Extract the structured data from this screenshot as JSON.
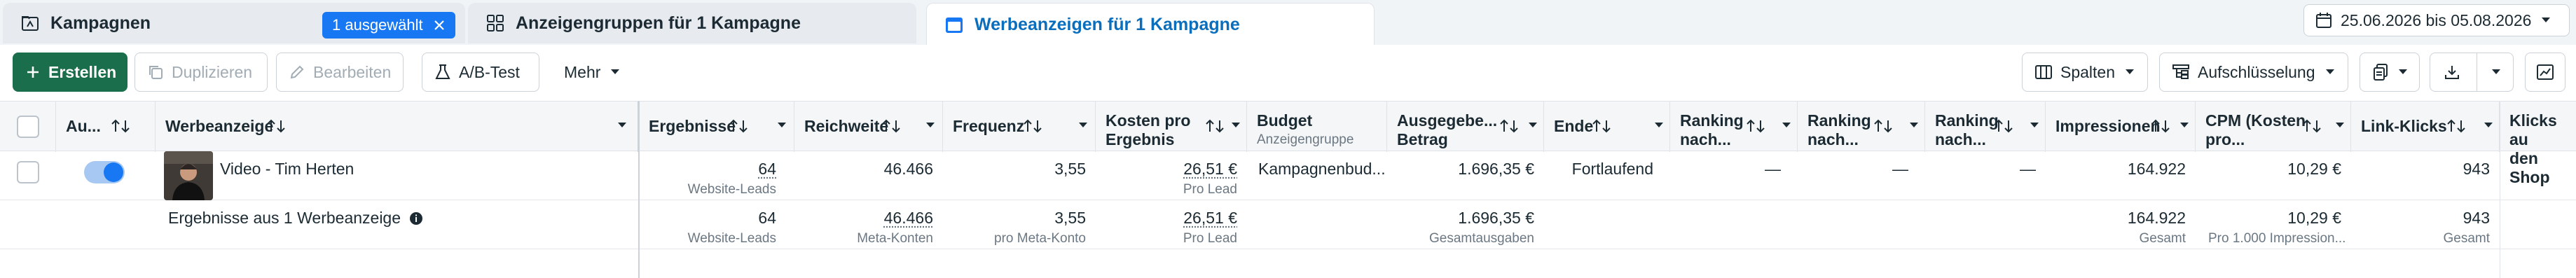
{
  "tabs": [
    {
      "label": "Kampagnen",
      "icon": "campaign-folder-icon"
    },
    {
      "label": "Anzeigengruppen für 1 Kampagne",
      "icon": "adset-grid-icon"
    },
    {
      "label": "Werbeanzeigen für 1 Kampagne",
      "icon": "ad-window-icon"
    }
  ],
  "selection_badge": "1 ausgewählt",
  "date_range": "25.06.2026 bis 05.08.2026",
  "toolbar": {
    "create": "Erstellen",
    "duplicate": "Duplizieren",
    "edit": "Bearbeiten",
    "ab_test": "A/B-Test",
    "more": "Mehr",
    "columns": "Spalten",
    "breakdown": "Aufschlüsselung"
  },
  "columns": {
    "status": "Au...",
    "ad": "Werbeanzeige",
    "results": "Ergebnisse",
    "reach": "Reichweite",
    "frequency": "Frequenz",
    "cost_per_result_1": "Kosten pro",
    "cost_per_result_2": "Ergebnis",
    "budget": "Budget",
    "budget_sub": "Anzeigengruppe",
    "spent_1": "Ausgegebe...",
    "spent_2": "Betrag",
    "end": "Ende",
    "rank1_1": "Ranking",
    "rank1_2": "nach...",
    "rank2_1": "Ranking",
    "rank2_2": "nach...",
    "rank3_1": "Ranking",
    "rank3_2": "nach...",
    "impressions": "Impressionen",
    "cpm_1": "CPM (Kosten",
    "cpm_2": "pro...",
    "link_clicks": "Link-Klicks",
    "clicks_1": "Klicks au",
    "clicks_2": "den Shop"
  },
  "ad_row": {
    "name": "Video - Tim Herten",
    "results": "64",
    "results_sub": "Website-Leads",
    "reach": "46.466",
    "frequency": "3,55",
    "cost_per_result": "26,51 €",
    "cost_per_result_sub": "Pro Lead",
    "budget": "Kampagnenbud...",
    "spent": "1.696,35 €",
    "end": "Fortlaufend",
    "rank1": "—",
    "rank2": "—",
    "rank3": "—",
    "impressions": "164.922",
    "cpm": "10,29 €",
    "link_clicks": "943"
  },
  "summary_row": {
    "label": "Ergebnisse aus 1 Werbeanzeige",
    "results": "64",
    "results_sub": "Website-Leads",
    "reach": "46.466",
    "reach_sub": "Meta-Konten",
    "frequency": "3,55",
    "frequency_sub": "pro Meta-Konto",
    "cost_per_result": "26,51 €",
    "cost_per_result_sub": "Pro Lead",
    "spent": "1.696,35 €",
    "spent_sub": "Gesamtausgaben",
    "impressions": "164.922",
    "impressions_sub": "Gesamt",
    "cpm": "10,29 €",
    "cpm_sub": "Pro 1.000 Impression...",
    "link_clicks": "943",
    "link_clicks_sub": "Gesamt"
  },
  "colors": {
    "accent_blue": "#1877f2",
    "create_green": "#1b6e4b",
    "active_tab_text": "#0a6ebd"
  }
}
